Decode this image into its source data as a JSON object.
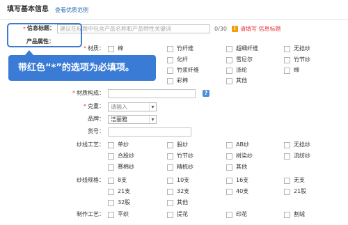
{
  "header": {
    "title": "填写基本信息",
    "example_link": "查看优质范例"
  },
  "title_field": {
    "required_mark": "*",
    "label": "信息标题：",
    "value": "",
    "placeholder": "建议在标题中包含产品名称和产品特性关键词",
    "counter": "0/30",
    "error_text": "请填写 信息标题"
  },
  "attributes_heading": "产品属性：",
  "tooltip": {
    "text": "带红色“*”的选项为必填项。"
  },
  "material": {
    "required_mark": "*",
    "label": "材质：",
    "rows": [
      [
        "棉",
        "竹纤维",
        "超细纤维",
        "无捻纱"
      ],
      [
        null,
        "化纤",
        "雪尼尔",
        "竹节纱"
      ],
      [
        null,
        "竹浆纤维",
        "涤纶",
        "绵"
      ],
      [
        null,
        "彩棉",
        "其他"
      ]
    ]
  },
  "composition": {
    "required_mark": "*",
    "label": "材质构成：",
    "value": ""
  },
  "weight": {
    "required_mark": "*",
    "label": "克重：",
    "selected": "请输入"
  },
  "brand": {
    "label": "品牌：",
    "selected": "洁丽雅"
  },
  "item_number": {
    "label": "货号：",
    "value": ""
  },
  "yarn_process": {
    "label": "纱线工艺：",
    "rows": [
      [
        "单纱",
        "股纱",
        "AB纱",
        "无捻纱"
      ],
      [
        "合股纱",
        "竹节纱",
        "树染纱",
        "流纺纱"
      ],
      [
        "赛棉纱",
        "精梳纱",
        "其他"
      ]
    ]
  },
  "yarn_count": {
    "label": "纱线规格：",
    "rows": [
      [
        "8支",
        "10支",
        "16支",
        "无支"
      ],
      [
        "21支",
        "32支",
        "40支",
        "21股"
      ],
      [
        "32股",
        "其他"
      ]
    ]
  },
  "craft": {
    "label": "制作工艺：",
    "rows": [
      [
        "平织",
        "提花",
        "印花",
        "割绒"
      ]
    ]
  },
  "icons": {
    "warning": {
      "name": "warning-icon",
      "glyph": "!"
    },
    "help": {
      "name": "help-icon",
      "glyph": "?"
    },
    "dropdown": {
      "name": "chevron-down-icon",
      "glyph": "▾"
    }
  },
  "colors": {
    "required": "#e4393c",
    "link": "#2b6cb0",
    "highlight": "#3d7ccc",
    "tooltip_bg": "#3a7bd5",
    "warning": "#f39c12",
    "help": "#4a90d9"
  }
}
